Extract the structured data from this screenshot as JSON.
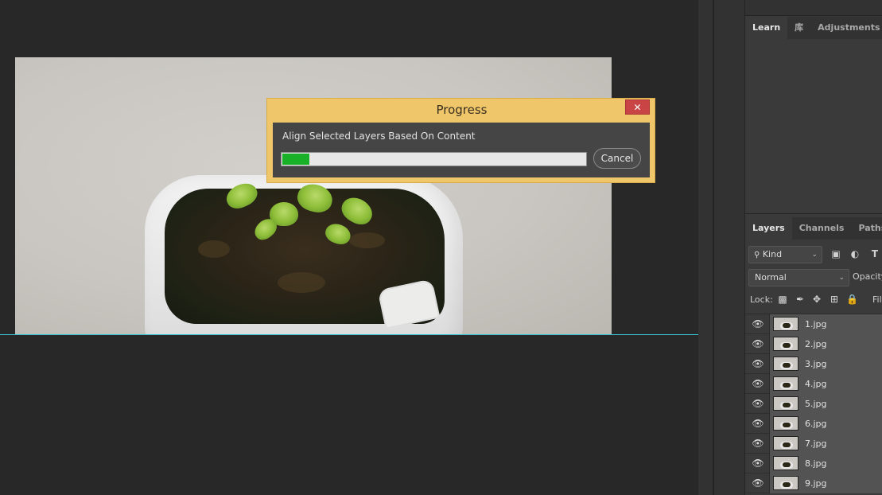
{
  "dialog": {
    "title": "Progress",
    "close_glyph": "✕",
    "message": "Align Selected Layers Based On Content",
    "progress_fraction": 0.09,
    "cancel_label": "Cancel",
    "progress_color": "#17b027"
  },
  "top_panel": {
    "tabs": [
      {
        "label": "Learn",
        "active": true
      },
      {
        "label": "库",
        "active": false
      },
      {
        "label": "Adjustments",
        "active": false
      }
    ]
  },
  "layers_panel": {
    "tabs": [
      {
        "label": "Layers",
        "active": true
      },
      {
        "label": "Channels",
        "active": false
      },
      {
        "label": "Paths",
        "active": false
      }
    ],
    "filter_kind": "Kind",
    "blend_mode": "Normal",
    "opacity_label": "Opacity",
    "lock_label": "Lock:",
    "fill_label": "Fil",
    "layers": [
      "1.jpg",
      "2.jpg",
      "3.jpg",
      "4.jpg",
      "5.jpg",
      "6.jpg",
      "7.jpg",
      "8.jpg",
      "9.jpg"
    ]
  },
  "icons": {
    "search": "search-icon",
    "filter_image": "image-filter-icon",
    "filter_adjustment": "adjustment-filter-icon",
    "filter_type": "type-filter-icon",
    "eye": "eye-icon"
  },
  "colors": {
    "guide": "#37c4d2",
    "dialog_frame": "#efc66a",
    "close_button": "#c94545"
  }
}
